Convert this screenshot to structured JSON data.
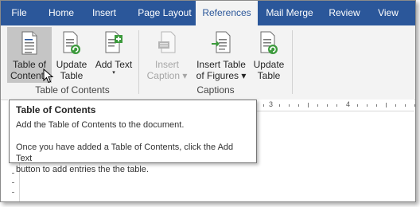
{
  "tabs": [
    {
      "label": "File"
    },
    {
      "label": "Home"
    },
    {
      "label": "Insert"
    },
    {
      "label": "Page Layout"
    },
    {
      "label": "References"
    },
    {
      "label": "Mail Merge"
    },
    {
      "label": "Review"
    },
    {
      "label": "View"
    }
  ],
  "active_tab": "References",
  "ribbon": {
    "toc_group": {
      "label": "Table of Contents",
      "buttons": [
        {
          "line1": "Table of",
          "line2": "Contents",
          "icon": "table-of-contents-icon"
        },
        {
          "line1": "Update",
          "line2": "Table",
          "icon": "update-table-icon"
        },
        {
          "line1": "Add Text",
          "line2": "▾",
          "icon": "add-text-icon"
        }
      ]
    },
    "captions_group": {
      "label": "Captions",
      "buttons": [
        {
          "line1": "Insert",
          "line2": "Caption ▾",
          "icon": "insert-caption-icon",
          "disabled": true
        },
        {
          "line1": "Insert Table",
          "line2": "of Figures ▾",
          "icon": "insert-table-of-figures-icon"
        },
        {
          "line1": "Update",
          "line2": "Table",
          "icon": "update-table-icon"
        }
      ]
    }
  },
  "ruler": {
    "marks": [
      "3",
      "4"
    ]
  },
  "tooltip": {
    "title": "Table of Contents",
    "line1": "Add the Table of Contents to the document.",
    "line2": "Once you have added a Table of Contents, click the Add Text",
    "line3": "button to add entries the the table."
  },
  "colors": {
    "tabbar": "#2b579a",
    "ribbon": "#f3f3f3",
    "hover": "#c5c5c5",
    "accent_green": "#3c9a3c"
  }
}
